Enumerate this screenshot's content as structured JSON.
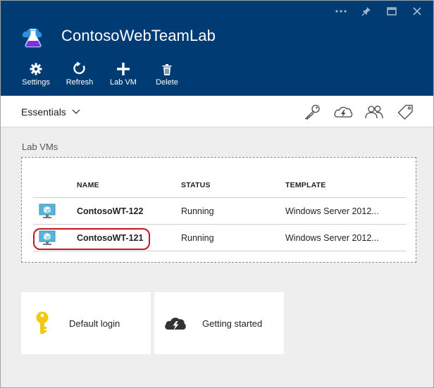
{
  "window": {
    "controls": [
      {
        "name": "more-icon"
      },
      {
        "name": "pin-icon"
      },
      {
        "name": "maximize-icon"
      },
      {
        "name": "close-icon"
      }
    ]
  },
  "header": {
    "title": "ContosoWebTeamLab",
    "icon": "lab-flask-icon"
  },
  "toolbar": {
    "settings_label": "Settings",
    "refresh_label": "Refresh",
    "labvm_label": "Lab VM",
    "delete_label": "Delete"
  },
  "essentials": {
    "label": "Essentials",
    "icons": [
      "key-icon",
      "cloud-lightning-icon",
      "users-icon",
      "tag-icon"
    ]
  },
  "labvms": {
    "section_label": "Lab VMs",
    "columns": {
      "name": "NAME",
      "status": "STATUS",
      "template": "TEMPLATE"
    },
    "rows": [
      {
        "name": "ContosoWT-122",
        "status": "Running",
        "template": "Windows Server 2012..."
      },
      {
        "name": "ContosoWT-121",
        "status": "Running",
        "template": "Windows Server 2012..."
      }
    ]
  },
  "tiles": {
    "default_login": "Default login",
    "getting_started": "Getting started"
  },
  "colors": {
    "header_bg": "#003b73",
    "highlight": "#c4161c",
    "key_icon": "#f2c811"
  }
}
